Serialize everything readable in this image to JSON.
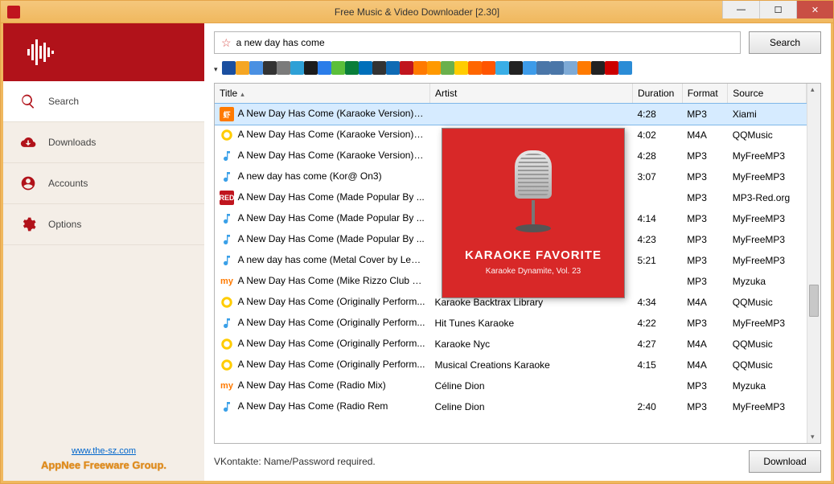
{
  "window": {
    "title": "Free Music & Video Downloader [2.30]"
  },
  "sidebar": {
    "items": [
      {
        "label": "Search"
      },
      {
        "label": "Downloads"
      },
      {
        "label": "Accounts"
      },
      {
        "label": "Options"
      }
    ],
    "link": "www.the-sz.com",
    "group": "AppNee Freeware Group."
  },
  "search": {
    "query": "a new day has come",
    "button": "Search"
  },
  "columns": {
    "title": "Title",
    "artist": "Artist",
    "duration": "Duration",
    "format": "Format",
    "source": "Source"
  },
  "rows": [
    {
      "title": "A New Day Has Come (Karaoke Version) [Originally Performed by Celine Dion]",
      "artist": "",
      "duration": "4:28",
      "format": "MP3",
      "source": "Xiami",
      "ico": "xiami"
    },
    {
      "title": "A New Day Has Come (Karaoke Version) [...",
      "artist": "",
      "duration": "4:02",
      "format": "M4A",
      "source": "QQMusic",
      "ico": "qq"
    },
    {
      "title": "A New Day Has Come (Karaoke Version) [...",
      "artist": "",
      "duration": "4:28",
      "format": "MP3",
      "source": "MyFreeMP3",
      "ico": "note"
    },
    {
      "title": "A new day has come (Kor@ On3)",
      "artist": "",
      "duration": "3:07",
      "format": "MP3",
      "source": "MyFreeMP3",
      "ico": "note"
    },
    {
      "title": "A New Day Has Come (Made Popular By ...",
      "artist": "",
      "duration": "",
      "format": "MP3",
      "source": "MP3-Red.org",
      "ico": "red"
    },
    {
      "title": "A New Day Has Come (Made Popular By ...",
      "artist": "",
      "duration": "4:14",
      "format": "MP3",
      "source": "MyFreeMP3",
      "ico": "note"
    },
    {
      "title": "A New Day Has Come (Made Popular By ...",
      "artist": "",
      "duration": "4:23",
      "format": "MP3",
      "source": "MyFreeMP3",
      "ico": "note"
    },
    {
      "title": "A new day has come (Metal Cover by Levi...",
      "artist": "",
      "duration": "5:21",
      "format": "MP3",
      "source": "MyFreeMP3",
      "ico": "note"
    },
    {
      "title": "A New Day Has Come (Mike Rizzo Club M...",
      "artist": "",
      "duration": "",
      "format": "MP3",
      "source": "Myzuka",
      "ico": "my"
    },
    {
      "title": "A New Day Has Come (Originally Perform...",
      "artist": "Karaoke Backtrax Library",
      "duration": "4:34",
      "format": "M4A",
      "source": "QQMusic",
      "ico": "qq"
    },
    {
      "title": "A New Day Has Come (Originally Perform...",
      "artist": "Hit Tunes Karaoke",
      "duration": "4:22",
      "format": "MP3",
      "source": "MyFreeMP3",
      "ico": "note"
    },
    {
      "title": "A New Day Has Come (Originally Perform...",
      "artist": "Karaoke Nyc",
      "duration": "4:27",
      "format": "M4A",
      "source": "QQMusic",
      "ico": "qq"
    },
    {
      "title": "A New Day Has Come (Originally Perform...",
      "artist": "Musical Creations Karaoke",
      "duration": "4:15",
      "format": "M4A",
      "source": "QQMusic",
      "ico": "qq"
    },
    {
      "title": "A New Day Has Come (Radio Mix)",
      "artist": "Céline Dion",
      "duration": "",
      "format": "MP3",
      "source": "Myzuka",
      "ico": "my"
    },
    {
      "title": "A New Day Has Come (Radio Rem",
      "artist": "Celine Dion",
      "duration": "2:40",
      "format": "MP3",
      "source": "MyFreeMP3",
      "ico": "note"
    }
  ],
  "status": "VKontakte: Name/Password required.",
  "download_button": "Download",
  "album": {
    "line1": "KARAOKE FAVORITE",
    "line2": "Karaoke Dynamite, Vol. 23"
  },
  "source_icons": [
    "#1a4fa0",
    "#f5a623",
    "#4a90e2",
    "#333",
    "#7b7b7b",
    "#2ea0d6",
    "#1c1c1c",
    "#2b7de9",
    "#5bbf3a",
    "#0a7e3a",
    "#006fba",
    "#333",
    "#0f6ab4",
    "#c0151e",
    "#ff7a00",
    "#ff9900",
    "#6ab04c",
    "#ffcc00",
    "#ff6600",
    "#ff5500",
    "#3aaee6",
    "#222",
    "#3d9be9",
    "#4a76a8",
    "#4a76a8",
    "#7eaad6",
    "#ff7a00",
    "#222",
    "#cc0000",
    "#2b8cd6"
  ]
}
